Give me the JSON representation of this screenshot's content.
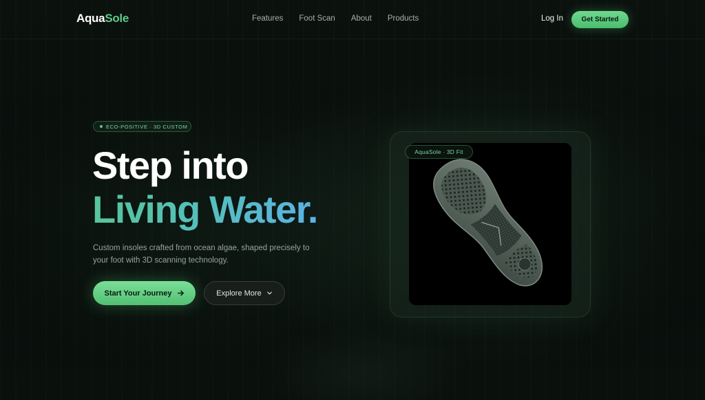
{
  "nav": {
    "logo_part1": "Aqua",
    "logo_part2": "Sole",
    "links": [
      "Features",
      "Foot Scan",
      "About",
      "Products"
    ],
    "login": "Log In",
    "cta": "Get Started"
  },
  "hero": {
    "badge": "ECO-POSITIVE · 3D CUSTOM",
    "headline_line1": "Step into",
    "headline_line2": "Living Water.",
    "subtext": "Custom insoles crafted from ocean algae, shaped precisely to your foot with 3D scanning technology.",
    "primary_button": "Start Your Journey",
    "secondary_button": "Explore More"
  },
  "card": {
    "label": "AquaSole · 3D Fit"
  },
  "colors": {
    "accent_green": "#5fc98a",
    "gradient_blue": "#5bb2e6",
    "background": "#070c09"
  },
  "icons": [
    "arrow-right-icon",
    "chevron-down-icon",
    "dot-icon"
  ]
}
